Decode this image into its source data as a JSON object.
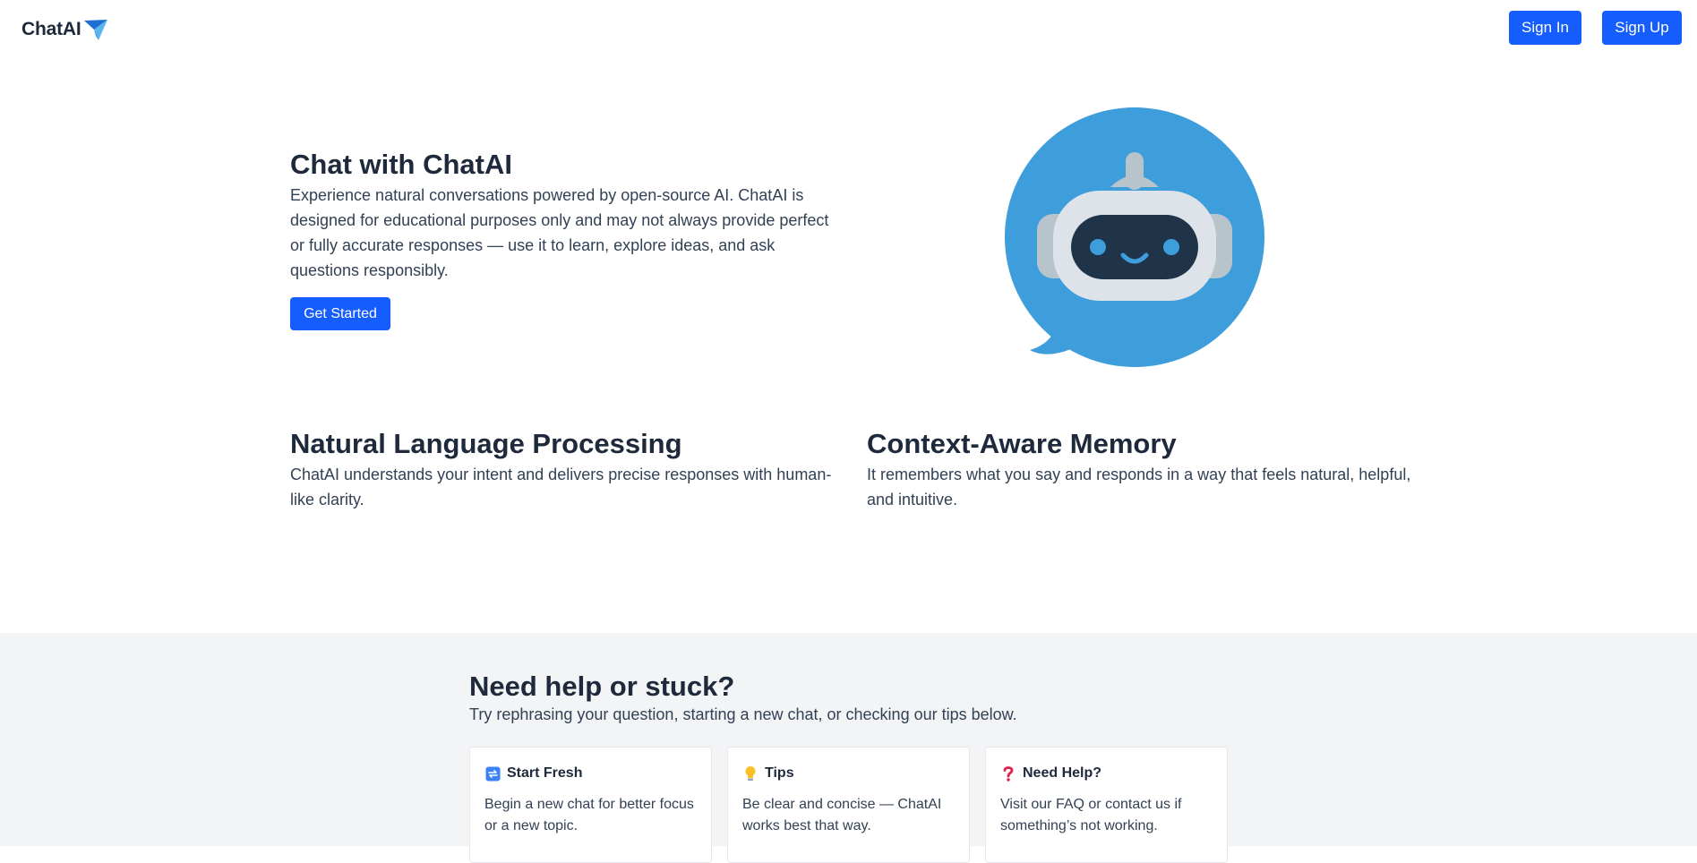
{
  "header": {
    "brand": "ChatAI",
    "sign_in": "Sign In",
    "sign_up": "Sign Up"
  },
  "hero": {
    "title": "Chat with ChatAI",
    "description": "Experience natural conversations powered by open-source AI. ChatAI is designed for educational purposes only and may not always provide perfect or fully accurate responses — use it to learn, explore ideas, and ask questions responsibly.",
    "cta": "Get Started",
    "illustration": "robot-chat-bubble-icon"
  },
  "features": [
    {
      "title": "Natural Language Processing",
      "description": "ChatAI understands your intent and delivers precise responses with human-like clarity."
    },
    {
      "title": "Context-Aware Memory",
      "description": "It remembers what you say and responds in a way that feels natural, helpful, and intuitive."
    }
  ],
  "help": {
    "title": "Need help or stuck?",
    "subtitle": "Try rephrasing your question, starting a new chat, or checking our tips below.",
    "cards": [
      {
        "icon": "refresh-icon",
        "title": "Start Fresh",
        "description": "Begin a new chat for better focus or a new topic."
      },
      {
        "icon": "lightbulb-icon",
        "title": "Tips",
        "description": "Be clear and concise — ChatAI works best that way."
      },
      {
        "icon": "question-mark-icon",
        "title": "Need Help?",
        "description": "Visit our FAQ or contact us if something’s not working."
      }
    ]
  },
  "colors": {
    "primary": "#155dfc",
    "bubble": "#3e9ddb",
    "help_bg": "#f2f4f6",
    "heading": "#1e293b"
  }
}
